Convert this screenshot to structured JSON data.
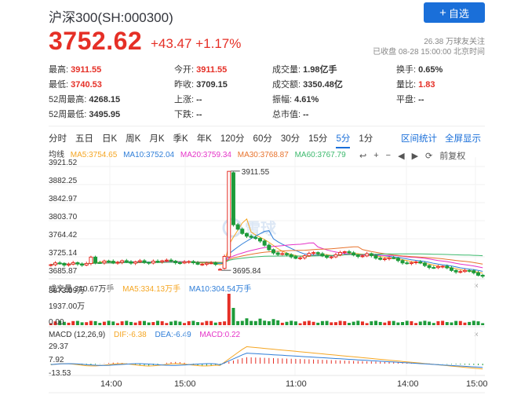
{
  "header": {
    "title": "沪深300(SH:000300)",
    "add_button": "自选",
    "price": "3752.62",
    "change": "+43.47",
    "change_pct": "+1.17%",
    "followers": "26.38 万球友关注",
    "status": "已收盘 08-28 15:00:00 北京时间"
  },
  "stats": {
    "high_label": "最高:",
    "high": "3911.55",
    "low_label": "最低:",
    "low": "3740.53",
    "w52h_label": "52周最高:",
    "w52h": "4268.15",
    "w52l_label": "52周最低:",
    "w52l": "3495.95",
    "open_label": "今开:",
    "open": "3911.55",
    "prev_label": "昨收:",
    "prev": "3709.15",
    "up_label": "上涨:",
    "up": "--",
    "down_label": "下跌:",
    "down": "--",
    "vol_label": "成交量:",
    "vol": "1.98亿手",
    "amt_label": "成交额:",
    "amt": "3350.48亿",
    "amp_label": "振幅:",
    "amp": "4.61%",
    "cap_label": "总市值:",
    "cap": "--",
    "turn_label": "换手:",
    "turn": "0.65%",
    "ratio_label": "量比:",
    "ratio": "1.83",
    "flat_label": "平盘:",
    "flat": "--"
  },
  "periods": [
    "分时",
    "五日",
    "日K",
    "周K",
    "月K",
    "季K",
    "年K",
    "120分",
    "60分",
    "30分",
    "15分",
    "5分",
    "1分"
  ],
  "active_period": "5分",
  "tools": {
    "interval_stats": "区间统计",
    "fullscreen": "全屏显示",
    "adjust": "前复权"
  },
  "ma": {
    "label": "均线",
    "ma5": "MA5:3754.65",
    "ma10": "MA10:3752.04",
    "ma20": "MA20:3759.34",
    "ma30": "MA30:3768.87",
    "ma60": "MA60:3767.79"
  },
  "volume": {
    "label": "成交量 310.67万手",
    "ma5": "MA5:334.13万手",
    "ma10": "MA10:304.54万手"
  },
  "macd": {
    "label": "MACD (12,26,9)",
    "dif": "DIF:-6.38",
    "dea": "DEA:-6.49",
    "macd": "MACD:0.22"
  },
  "price_axis": [
    "3921.52",
    "3882.25",
    "3842.97",
    "3803.70",
    "3764.42",
    "3725.14",
    "3685.87"
  ],
  "vol_axis": [
    "3873.99万",
    "1937.00万",
    "0.00"
  ],
  "macd_axis": [
    "29.37",
    "7.92",
    "-13.53"
  ],
  "annotations": {
    "high": "3911.55",
    "low": "3695.84"
  },
  "x_axis": [
    "14:00",
    "15:00",
    "11:00",
    "14:00",
    "15:00"
  ],
  "colors": {
    "up": "#e52f26",
    "down": "#1d9b3a",
    "accent": "#1a6fd9",
    "ma5": "#f5a623",
    "ma10": "#2f7ed8",
    "ma20": "#e533c8",
    "ma30": "#e8732d",
    "ma60": "#3cb96d"
  },
  "watermark": "雪球",
  "chart_data": {
    "type": "candlestick",
    "title": "",
    "ylim": [
      3685.87,
      3921.52
    ],
    "x_labels": [
      "14:00",
      "15:00",
      "11:00",
      "14:00",
      "15:00"
    ],
    "annotations": [
      {
        "label": "3911.55",
        "value": 3911.55
      },
      {
        "label": "3695.84",
        "value": 3695.84
      }
    ]
  }
}
